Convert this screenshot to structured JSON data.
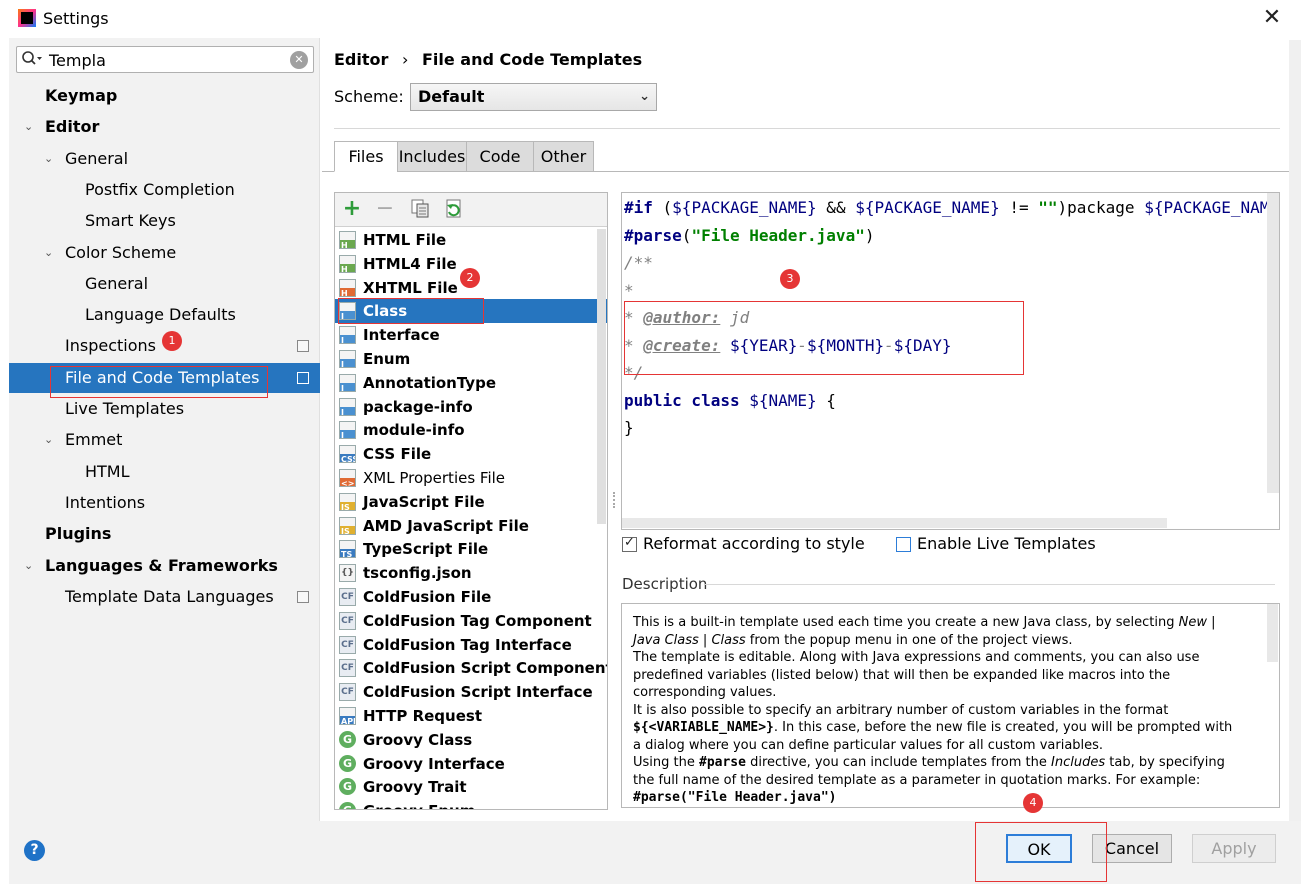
{
  "window": {
    "title": "Settings",
    "close_glyph": "✕"
  },
  "search": {
    "value": "Templa",
    "icon": "search-icon",
    "clear_glyph": "✕"
  },
  "sidebar": {
    "items": [
      {
        "label": "Keymap",
        "level": 0,
        "bold": true,
        "arrow": ""
      },
      {
        "label": "Editor",
        "level": 0,
        "bold": true,
        "arrow": "⌄"
      },
      {
        "label": "General",
        "level": 1,
        "bold": false,
        "arrow": "⌄"
      },
      {
        "label": "Postfix Completion",
        "level": 2,
        "bold": false,
        "arrow": ""
      },
      {
        "label": "Smart Keys",
        "level": 2,
        "bold": false,
        "arrow": ""
      },
      {
        "label": "Color Scheme",
        "level": 1,
        "bold": false,
        "arrow": "⌄"
      },
      {
        "label": "General",
        "level": 2,
        "bold": false,
        "arrow": ""
      },
      {
        "label": "Language Defaults",
        "level": 2,
        "bold": false,
        "arrow": ""
      },
      {
        "label": "Inspections",
        "level": 1,
        "bold": false,
        "arrow": "",
        "side_icon": true
      },
      {
        "label": "File and Code Templates",
        "level": 1,
        "bold": false,
        "arrow": "",
        "side_icon": true,
        "selected": true
      },
      {
        "label": "Live Templates",
        "level": 1,
        "bold": false,
        "arrow": ""
      },
      {
        "label": "Emmet",
        "level": 1,
        "bold": false,
        "arrow": "⌄"
      },
      {
        "label": "HTML",
        "level": 2,
        "bold": false,
        "arrow": ""
      },
      {
        "label": "Intentions",
        "level": 1,
        "bold": false,
        "arrow": ""
      },
      {
        "label": "Plugins",
        "level": 0,
        "bold": true,
        "arrow": ""
      },
      {
        "label": "Languages & Frameworks",
        "level": 0,
        "bold": true,
        "arrow": "⌄"
      },
      {
        "label": "Template Data Languages",
        "level": 1,
        "bold": false,
        "arrow": "",
        "side_icon": true
      }
    ]
  },
  "breadcrumb": {
    "part1": "Editor",
    "sep": "›",
    "part2": "File and Code Templates"
  },
  "scheme": {
    "label": "Scheme:",
    "value": "Default",
    "dropdown_glyph": "⌄"
  },
  "tabs": [
    {
      "label": "Files",
      "active": true
    },
    {
      "label": "Includes",
      "active": false
    },
    {
      "label": "Code",
      "active": false
    },
    {
      "label": "Other",
      "active": false
    }
  ],
  "toolbar": {
    "add": "+",
    "remove": "−"
  },
  "files": [
    {
      "label": "HTML File",
      "icon": "H",
      "color": "#6aa84f",
      "bold": true
    },
    {
      "label": "HTML4 File",
      "icon": "H",
      "color": "#6aa84f",
      "bold": true
    },
    {
      "label": "XHTML File",
      "icon": "H",
      "color": "#e06a34",
      "bold": true
    },
    {
      "label": "Class",
      "icon": "J",
      "color": "#4a90d0",
      "bold": true,
      "selected": true
    },
    {
      "label": "Interface",
      "icon": "J",
      "color": "#4a90d0",
      "bold": true
    },
    {
      "label": "Enum",
      "icon": "J",
      "color": "#4a90d0",
      "bold": true
    },
    {
      "label": "AnnotationType",
      "icon": "J",
      "color": "#4a90d0",
      "bold": true
    },
    {
      "label": "package-info",
      "icon": "J",
      "color": "#4a90d0",
      "bold": true
    },
    {
      "label": "module-info",
      "icon": "J",
      "color": "#4a90d0",
      "bold": true
    },
    {
      "label": "CSS File",
      "icon": "CSS",
      "color": "#3a7bc0",
      "bold": true
    },
    {
      "label": "XML Properties File",
      "icon": "<>",
      "color": "#e06a34",
      "bold": false
    },
    {
      "label": "JavaScript File",
      "icon": "JS",
      "color": "#e0b030",
      "bold": true
    },
    {
      "label": "AMD JavaScript File",
      "icon": "JS",
      "color": "#e0b030",
      "bold": true
    },
    {
      "label": "TypeScript File",
      "icon": "TS",
      "color": "#3a7bc0",
      "bold": true
    },
    {
      "label": "tsconfig.json",
      "icon": "{}",
      "color": "#888888",
      "bold": true
    },
    {
      "label": "ColdFusion File",
      "icon": "CF",
      "color": "#5a6e8c",
      "bold": true
    },
    {
      "label": "ColdFusion Tag Component",
      "icon": "CF",
      "color": "#5a6e8c",
      "bold": true
    },
    {
      "label": "ColdFusion Tag Interface",
      "icon": "CF",
      "color": "#5a6e8c",
      "bold": true
    },
    {
      "label": "ColdFusion Script Component",
      "icon": "CF",
      "color": "#5a6e8c",
      "bold": true
    },
    {
      "label": "ColdFusion Script Interface",
      "icon": "CF",
      "color": "#5a6e8c",
      "bold": true
    },
    {
      "label": "HTTP Request",
      "icon": "API",
      "color": "#3a7bc0",
      "bold": true
    },
    {
      "label": "Groovy Class",
      "icon": "G",
      "color": "#5fae5f",
      "bold": true
    },
    {
      "label": "Groovy Interface",
      "icon": "G",
      "color": "#5fae5f",
      "bold": true
    },
    {
      "label": "Groovy Trait",
      "icon": "G",
      "color": "#5fae5f",
      "bold": true
    },
    {
      "label": "Groovy Enum",
      "icon": "G",
      "color": "#5fae5f",
      "bold": true
    }
  ],
  "code": {
    "l1": [
      "#if",
      " (",
      "${PACKAGE_NAME}",
      " && ",
      "${PACKAGE_NAME}",
      " != ",
      "\"\"",
      ")package ",
      "${PACKAGE_NAM"
    ],
    "l2": [
      "#parse",
      "(",
      "\"File Header.java\"",
      ")"
    ],
    "l3": "/**",
    "l4": "*",
    "l5": [
      "* ",
      "@author:",
      " jd"
    ],
    "l6": [
      "* ",
      "@create:",
      " ",
      "${YEAR}",
      "-",
      "${MONTH}",
      "-",
      "${DAY}"
    ],
    "l7": "*/",
    "l8": [
      "public class ",
      "${NAME}",
      " {"
    ],
    "l9": "}"
  },
  "options": {
    "reformat": {
      "label": "Reformat according to style",
      "checked": true
    },
    "live": {
      "label": "Enable Live Templates",
      "checked": false
    }
  },
  "description": {
    "label": "Description",
    "p1a": "This is a built-in template used each time you create a new Java class, by selecting ",
    "p1b": "New | Java Class | Class",
    "p1c": " from the popup menu in one of the project views.",
    "p2": "The template is editable. Along with Java expressions and comments, you can also use predefined variables (listed below) that will then be expanded like macros into the corresponding values.",
    "p3a": "It is also possible to specify an arbitrary number of custom variables in the format ",
    "p3b": "${<VARIABLE_NAME>}",
    "p3c": ". In this case, before the new file is created, you will be prompted with a dialog where you can define particular values for all custom variables.",
    "p4a": "Using the ",
    "p4b": "#parse",
    "p4c": " directive, you can include templates from the ",
    "p4d": "Includes",
    "p4e": " tab, by specifying the full name of the desired template as a parameter in quotation marks. For example:",
    "p5": "#parse(\"File Header.java\")"
  },
  "buttons": {
    "ok": "OK",
    "cancel": "Cancel",
    "apply": "Apply",
    "help": "?"
  },
  "annotations": [
    "1",
    "2",
    "3",
    "4"
  ]
}
